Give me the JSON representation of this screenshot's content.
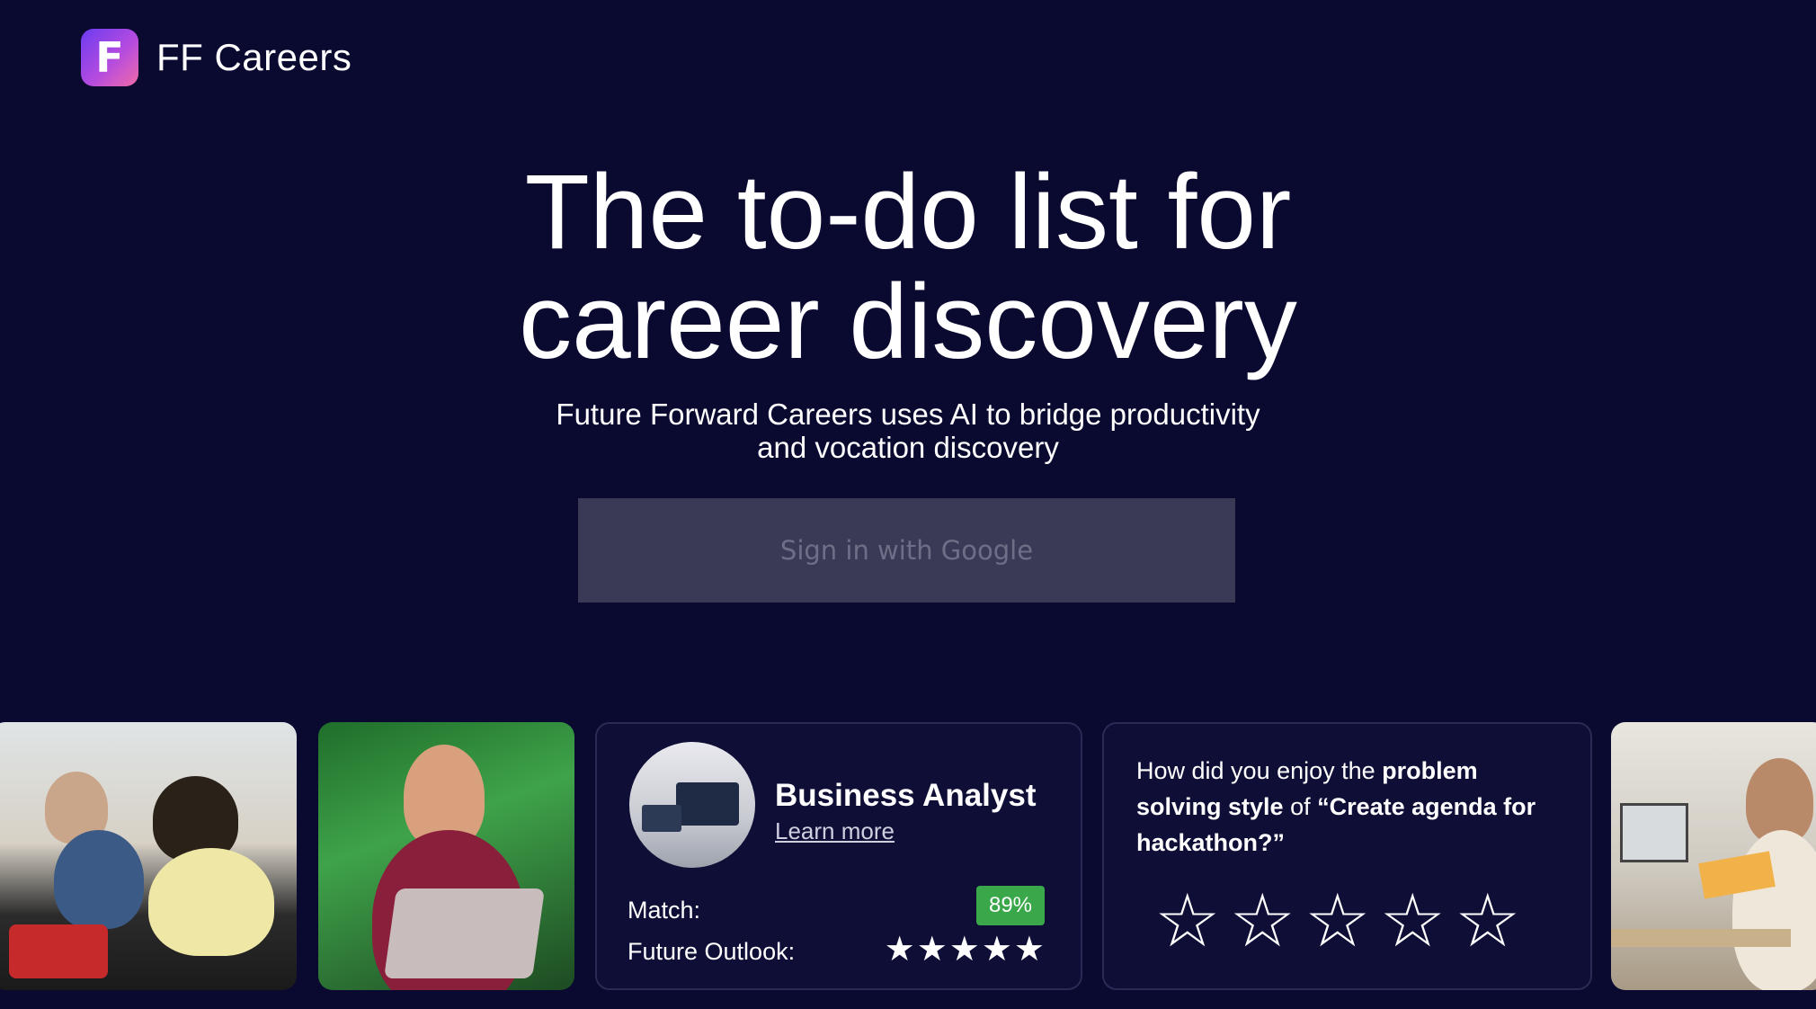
{
  "brand": {
    "logo_letter": "F",
    "name": "FF Careers"
  },
  "hero": {
    "title_line1": "The to-do list for",
    "title_line2": "career discovery",
    "subtitle_line1": "Future Forward Careers uses AI to bridge productivity",
    "subtitle_line2": "and vocation discovery"
  },
  "signin": {
    "label": "Sign in with Google"
  },
  "career_card": {
    "title": "Business Analyst",
    "link": "Learn more",
    "match_label": "Match:",
    "match_value": "89%",
    "outlook_label": "Future Outlook:",
    "outlook_stars": "★★★★★",
    "outlook_rating": 5
  },
  "feedback_card": {
    "prefix": "How did you enjoy the ",
    "highlight1": "problem solving style",
    "middle": " of ",
    "highlight2": "“Create agenda for hackathon?”",
    "stars": "☆☆☆☆☆",
    "rating": 0
  },
  "colors": {
    "background": "#0a0930",
    "match_badge": "#3aa84a",
    "button": "#3b3a56"
  }
}
